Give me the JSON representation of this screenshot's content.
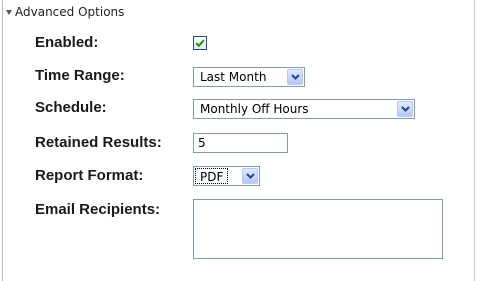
{
  "section": {
    "title": "Advanced Options",
    "expanded": true
  },
  "fields": {
    "enabled": {
      "label": "Enabled:",
      "checked": true
    },
    "time_range": {
      "label": "Time Range:",
      "value": "Last Month"
    },
    "schedule": {
      "label": "Schedule:",
      "value": "Monthly Off Hours"
    },
    "retained_results": {
      "label": "Retained Results:",
      "value": "5"
    },
    "report_format": {
      "label": "Report Format:",
      "value": "PDF"
    },
    "email_recipients": {
      "label": "Email Recipients:",
      "value": ""
    }
  },
  "colors": {
    "checkmark": "#1e8c1e",
    "input_border": "#7f9db9",
    "dropdown_button": "#b4c8f6"
  }
}
